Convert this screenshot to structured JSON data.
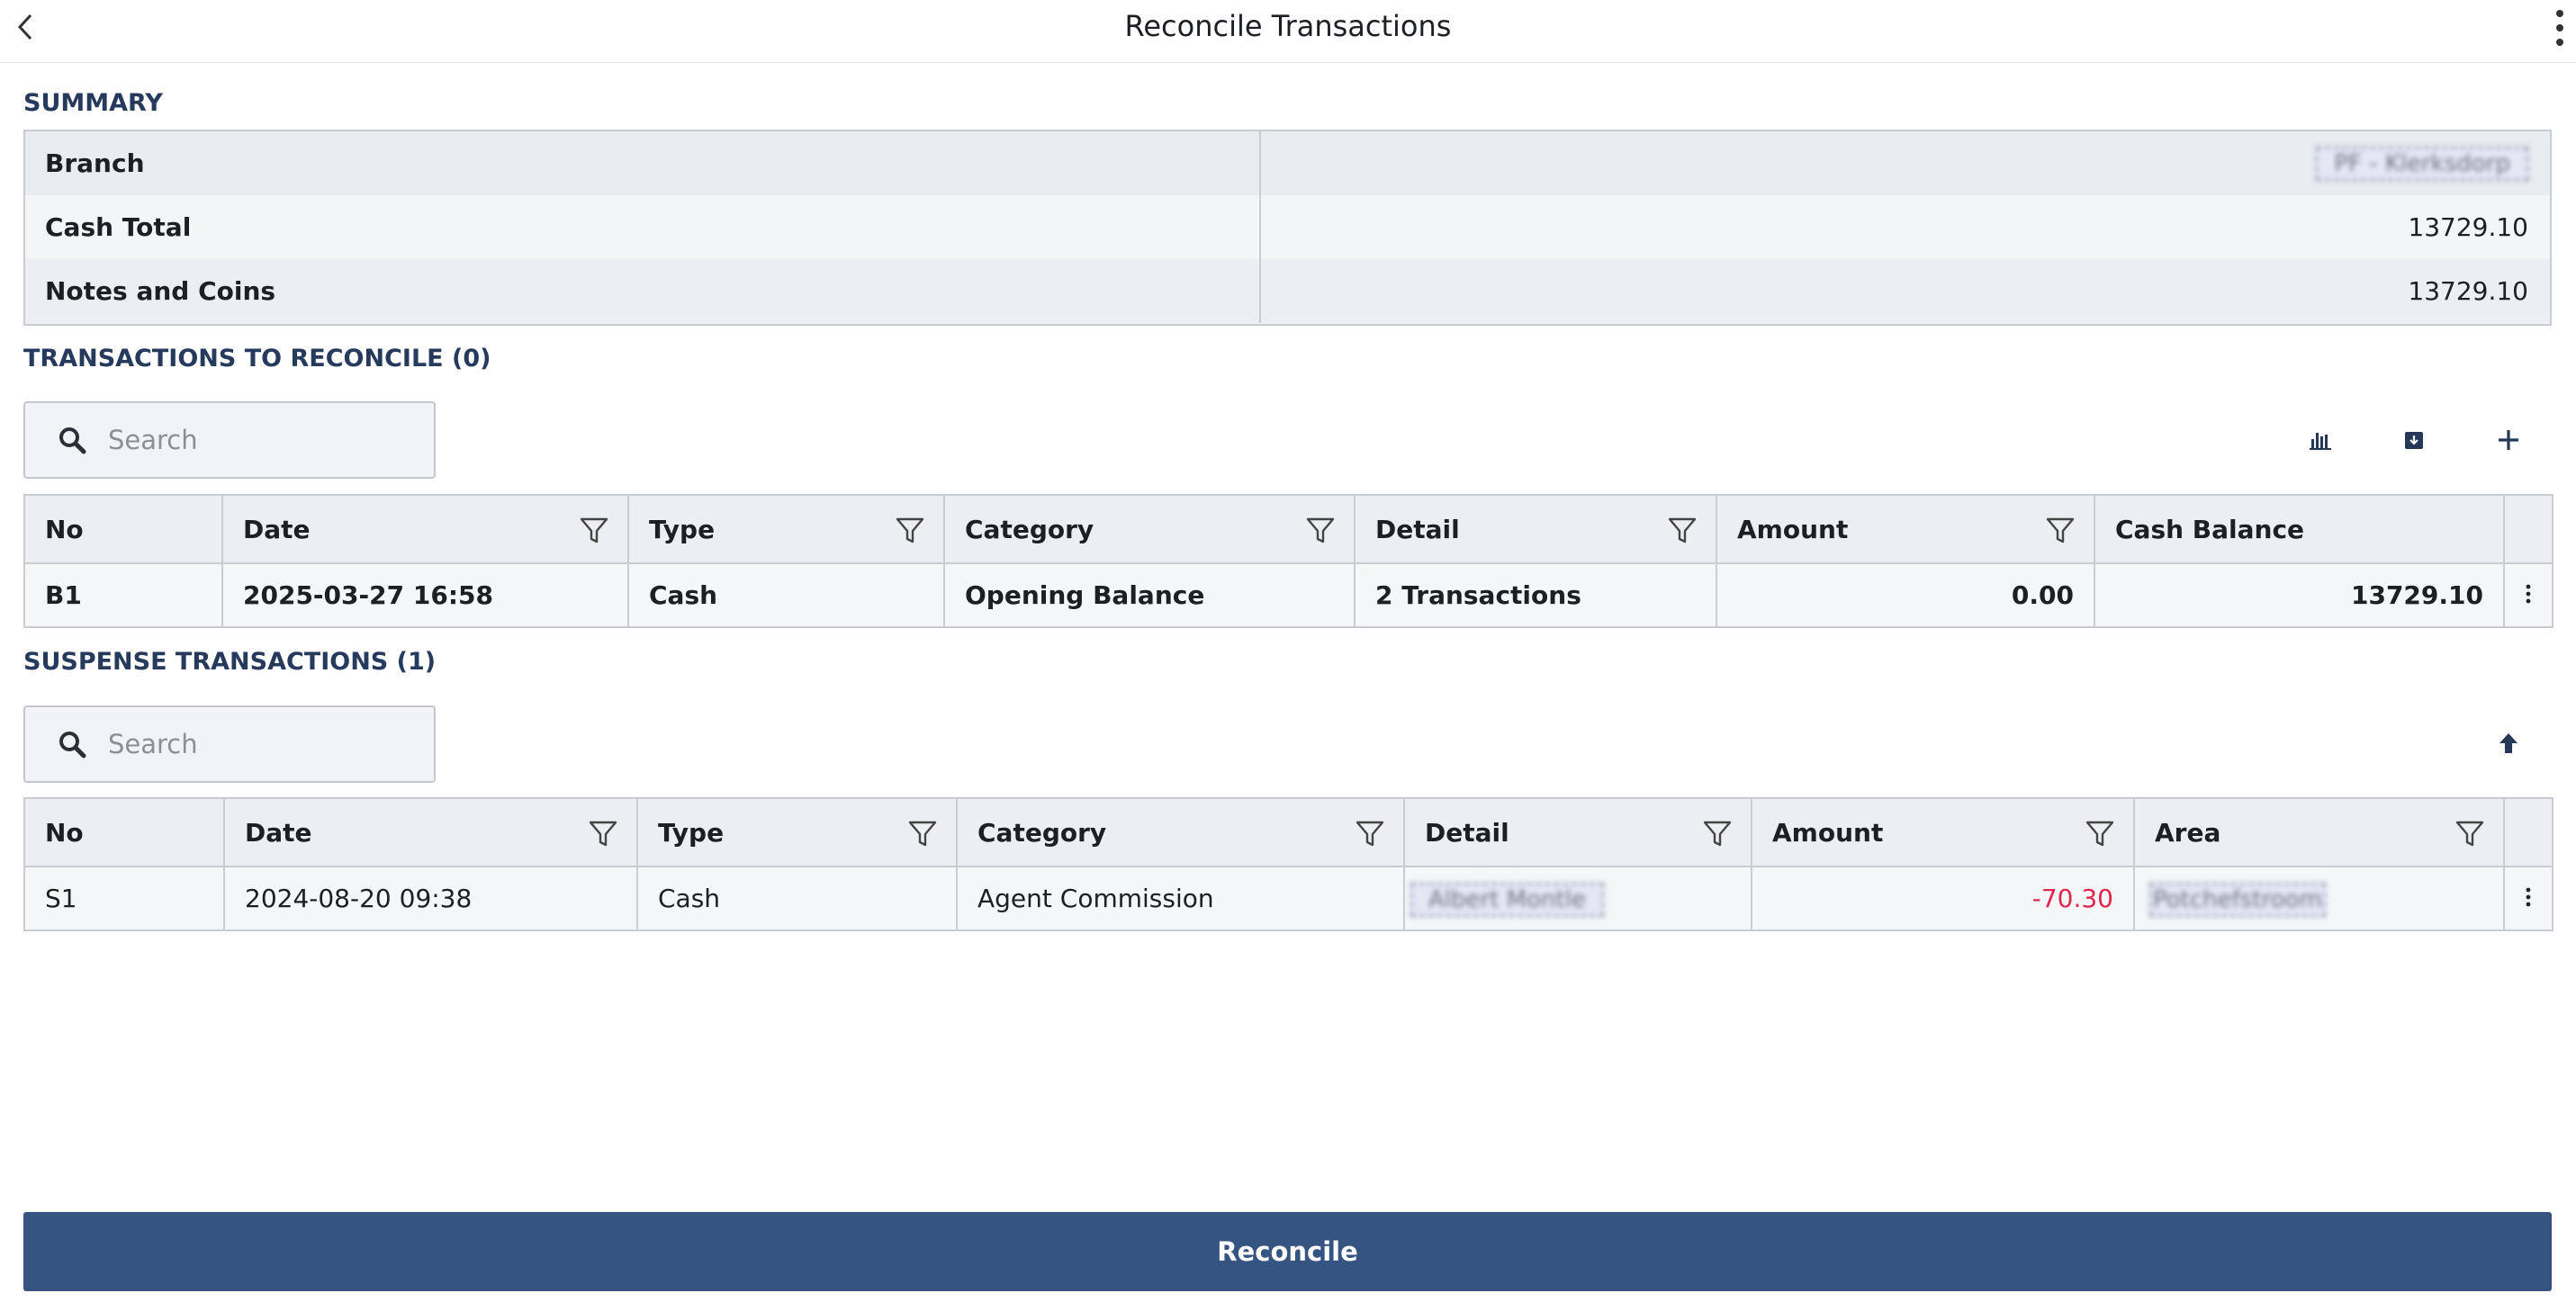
{
  "header": {
    "title": "Reconcile Transactions",
    "back_icon": "chevron-left-icon",
    "more_icon": "kebab-icon"
  },
  "summary": {
    "title": "SUMMARY",
    "rows": [
      {
        "label": "Branch",
        "value": "PF - Klerksdorp"
      },
      {
        "label": "Cash Total",
        "value": "13729.10"
      },
      {
        "label": "Notes and Coins",
        "value": "13729.10"
      }
    ]
  },
  "reconcile_section": {
    "title": "TRANSACTIONS TO RECONCILE (0)",
    "search_placeholder": "Search",
    "toolbar_icons": [
      "bar-chart-icon",
      "download-box-icon",
      "plus-icon"
    ],
    "columns": [
      "No",
      "Date",
      "Type",
      "Category",
      "Detail",
      "Amount",
      "Cash Balance"
    ],
    "rows": [
      {
        "no": "B1",
        "date": "2025-03-27 16:58",
        "type": "Cash",
        "category": "Opening Balance",
        "detail": "2 Transactions",
        "amount": "0.00",
        "cash_balance": "13729.10"
      }
    ]
  },
  "suspense_section": {
    "title": "SUSPENSE TRANSACTIONS (1)",
    "search_placeholder": "Search",
    "toolbar_icons": [
      "upload-arrow-icon"
    ],
    "columns": [
      "No",
      "Date",
      "Type",
      "Category",
      "Detail",
      "Amount",
      "Area"
    ],
    "rows": [
      {
        "no": "S1",
        "date": "2024-08-20 09:38",
        "type": "Cash",
        "category": "Agent Commission",
        "detail": "Albert Montle",
        "amount": "-70.30",
        "area": "Potchefstroom"
      }
    ]
  },
  "footer": {
    "reconcile_label": "Reconcile"
  },
  "colors": {
    "accent": "#365482",
    "section_title": "#263a5e",
    "negative": "#e0264f"
  }
}
